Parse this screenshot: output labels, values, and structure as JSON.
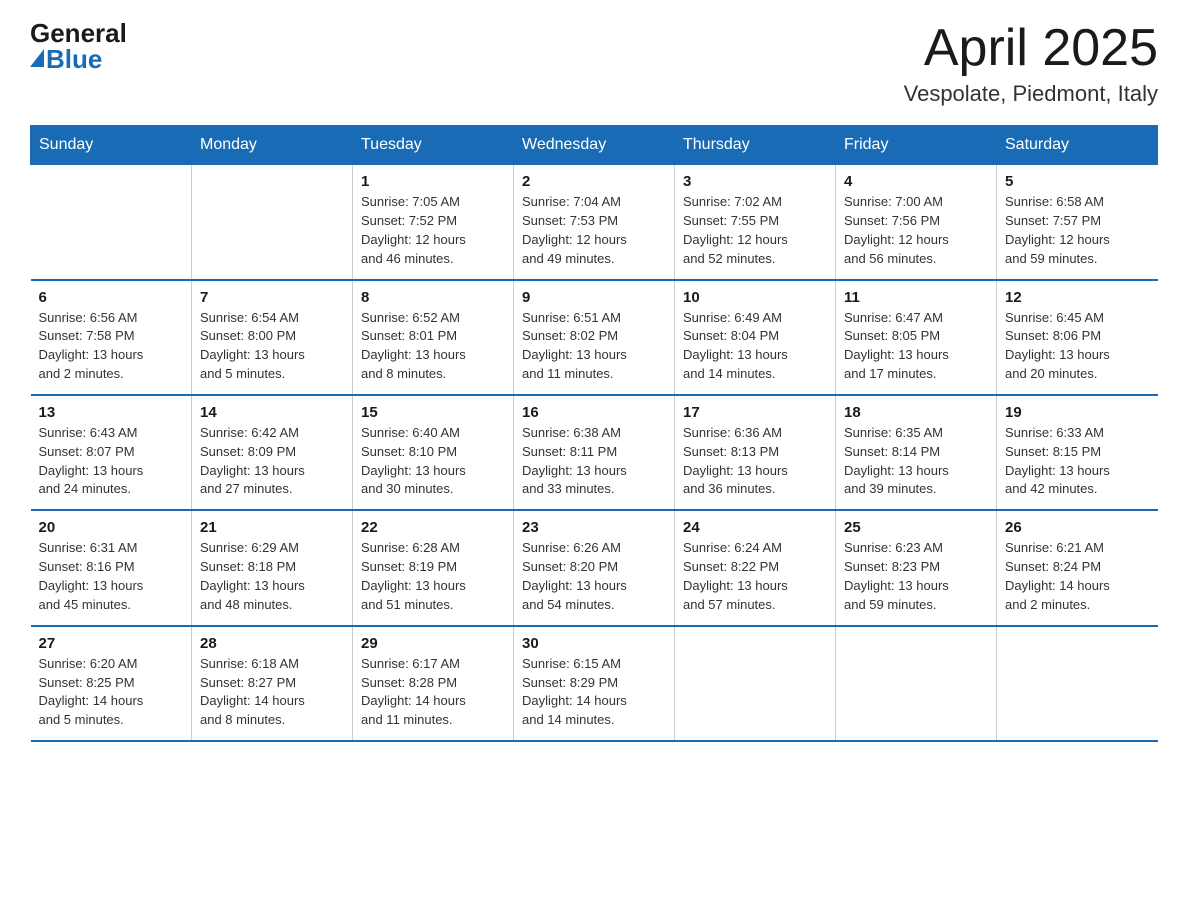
{
  "logo": {
    "general": "General",
    "blue": "Blue"
  },
  "title": "April 2025",
  "subtitle": "Vespolate, Piedmont, Italy",
  "header_color": "#1a6bb5",
  "days_of_week": [
    "Sunday",
    "Monday",
    "Tuesday",
    "Wednesday",
    "Thursday",
    "Friday",
    "Saturday"
  ],
  "weeks": [
    [
      {
        "num": "",
        "info": ""
      },
      {
        "num": "",
        "info": ""
      },
      {
        "num": "1",
        "info": "Sunrise: 7:05 AM\nSunset: 7:52 PM\nDaylight: 12 hours\nand 46 minutes."
      },
      {
        "num": "2",
        "info": "Sunrise: 7:04 AM\nSunset: 7:53 PM\nDaylight: 12 hours\nand 49 minutes."
      },
      {
        "num": "3",
        "info": "Sunrise: 7:02 AM\nSunset: 7:55 PM\nDaylight: 12 hours\nand 52 minutes."
      },
      {
        "num": "4",
        "info": "Sunrise: 7:00 AM\nSunset: 7:56 PM\nDaylight: 12 hours\nand 56 minutes."
      },
      {
        "num": "5",
        "info": "Sunrise: 6:58 AM\nSunset: 7:57 PM\nDaylight: 12 hours\nand 59 minutes."
      }
    ],
    [
      {
        "num": "6",
        "info": "Sunrise: 6:56 AM\nSunset: 7:58 PM\nDaylight: 13 hours\nand 2 minutes."
      },
      {
        "num": "7",
        "info": "Sunrise: 6:54 AM\nSunset: 8:00 PM\nDaylight: 13 hours\nand 5 minutes."
      },
      {
        "num": "8",
        "info": "Sunrise: 6:52 AM\nSunset: 8:01 PM\nDaylight: 13 hours\nand 8 minutes."
      },
      {
        "num": "9",
        "info": "Sunrise: 6:51 AM\nSunset: 8:02 PM\nDaylight: 13 hours\nand 11 minutes."
      },
      {
        "num": "10",
        "info": "Sunrise: 6:49 AM\nSunset: 8:04 PM\nDaylight: 13 hours\nand 14 minutes."
      },
      {
        "num": "11",
        "info": "Sunrise: 6:47 AM\nSunset: 8:05 PM\nDaylight: 13 hours\nand 17 minutes."
      },
      {
        "num": "12",
        "info": "Sunrise: 6:45 AM\nSunset: 8:06 PM\nDaylight: 13 hours\nand 20 minutes."
      }
    ],
    [
      {
        "num": "13",
        "info": "Sunrise: 6:43 AM\nSunset: 8:07 PM\nDaylight: 13 hours\nand 24 minutes."
      },
      {
        "num": "14",
        "info": "Sunrise: 6:42 AM\nSunset: 8:09 PM\nDaylight: 13 hours\nand 27 minutes."
      },
      {
        "num": "15",
        "info": "Sunrise: 6:40 AM\nSunset: 8:10 PM\nDaylight: 13 hours\nand 30 minutes."
      },
      {
        "num": "16",
        "info": "Sunrise: 6:38 AM\nSunset: 8:11 PM\nDaylight: 13 hours\nand 33 minutes."
      },
      {
        "num": "17",
        "info": "Sunrise: 6:36 AM\nSunset: 8:13 PM\nDaylight: 13 hours\nand 36 minutes."
      },
      {
        "num": "18",
        "info": "Sunrise: 6:35 AM\nSunset: 8:14 PM\nDaylight: 13 hours\nand 39 minutes."
      },
      {
        "num": "19",
        "info": "Sunrise: 6:33 AM\nSunset: 8:15 PM\nDaylight: 13 hours\nand 42 minutes."
      }
    ],
    [
      {
        "num": "20",
        "info": "Sunrise: 6:31 AM\nSunset: 8:16 PM\nDaylight: 13 hours\nand 45 minutes."
      },
      {
        "num": "21",
        "info": "Sunrise: 6:29 AM\nSunset: 8:18 PM\nDaylight: 13 hours\nand 48 minutes."
      },
      {
        "num": "22",
        "info": "Sunrise: 6:28 AM\nSunset: 8:19 PM\nDaylight: 13 hours\nand 51 minutes."
      },
      {
        "num": "23",
        "info": "Sunrise: 6:26 AM\nSunset: 8:20 PM\nDaylight: 13 hours\nand 54 minutes."
      },
      {
        "num": "24",
        "info": "Sunrise: 6:24 AM\nSunset: 8:22 PM\nDaylight: 13 hours\nand 57 minutes."
      },
      {
        "num": "25",
        "info": "Sunrise: 6:23 AM\nSunset: 8:23 PM\nDaylight: 13 hours\nand 59 minutes."
      },
      {
        "num": "26",
        "info": "Sunrise: 6:21 AM\nSunset: 8:24 PM\nDaylight: 14 hours\nand 2 minutes."
      }
    ],
    [
      {
        "num": "27",
        "info": "Sunrise: 6:20 AM\nSunset: 8:25 PM\nDaylight: 14 hours\nand 5 minutes."
      },
      {
        "num": "28",
        "info": "Sunrise: 6:18 AM\nSunset: 8:27 PM\nDaylight: 14 hours\nand 8 minutes."
      },
      {
        "num": "29",
        "info": "Sunrise: 6:17 AM\nSunset: 8:28 PM\nDaylight: 14 hours\nand 11 minutes."
      },
      {
        "num": "30",
        "info": "Sunrise: 6:15 AM\nSunset: 8:29 PM\nDaylight: 14 hours\nand 14 minutes."
      },
      {
        "num": "",
        "info": ""
      },
      {
        "num": "",
        "info": ""
      },
      {
        "num": "",
        "info": ""
      }
    ]
  ]
}
